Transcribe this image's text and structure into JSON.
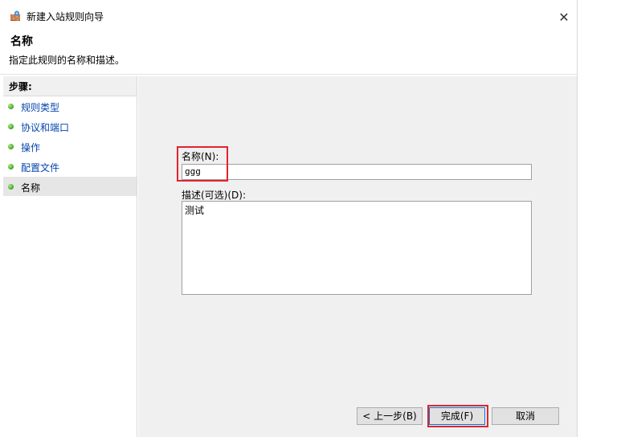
{
  "window": {
    "title": "新建入站规则向导",
    "close_glyph": "✕"
  },
  "header": {
    "title": "名称",
    "subtitle": "指定此规则的名称和描述。"
  },
  "steps": {
    "heading": "步骤:",
    "items": [
      {
        "label": "规则类型",
        "active": false
      },
      {
        "label": "协议和端口",
        "active": false
      },
      {
        "label": "操作",
        "active": false
      },
      {
        "label": "配置文件",
        "active": false
      },
      {
        "label": "名称",
        "active": true
      }
    ]
  },
  "form": {
    "name_label": "名称(N):",
    "name_value": "ggg",
    "desc_label": "描述(可选)(D):",
    "desc_value": "测试"
  },
  "buttons": {
    "back": "< 上一步(B)",
    "finish": "完成(F)",
    "cancel": "取消"
  },
  "colors": {
    "highlight": "#e0242f",
    "link": "#0645ad",
    "step_dot": "#3fa12a"
  },
  "icons": [
    "firewall-wizard-icon",
    "close-icon",
    "step-bullet-icon"
  ]
}
